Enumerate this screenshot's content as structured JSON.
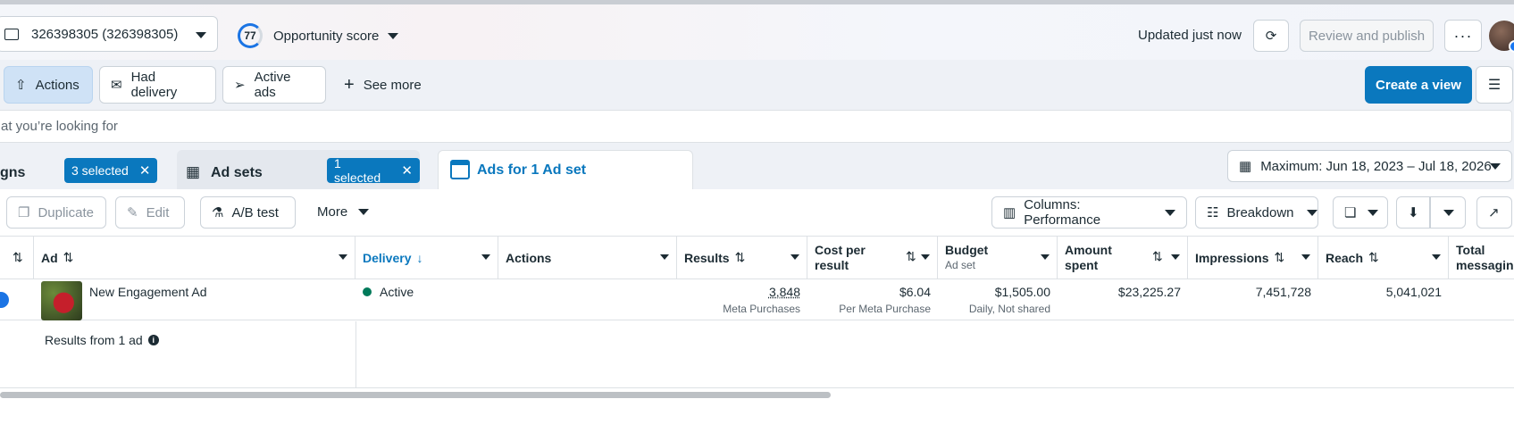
{
  "header": {
    "account_label": "326398305 (326398305)",
    "opportunity_score": "77",
    "opportunity_label": "Opportunity score",
    "updated": "Updated just now",
    "review_publish": "Review and publish",
    "more": "···"
  },
  "filters": {
    "items": [
      {
        "label": "Actions",
        "icon": "upload-circle-icon",
        "active": true
      },
      {
        "label": "Had delivery",
        "icon": "envelope-icon"
      },
      {
        "label": "Active ads",
        "icon": "send-icon"
      }
    ],
    "see_more": "See more",
    "create_view": "Create a view"
  },
  "search": {
    "placeholder": "at you’re looking for"
  },
  "tabs": {
    "campaigns_label": "gns",
    "campaigns_selected": "3 selected",
    "adsets_label": "Ad sets",
    "adsets_selected": "1 selected",
    "ads_label": "Ads for 1 Ad set"
  },
  "date_range": "Maximum: Jun 18, 2023 – Jul 18, 2026",
  "toolbar": {
    "duplicate": "Duplicate",
    "edit": "Edit",
    "ab_test": "A/B test",
    "more": "More",
    "columns": "Columns: Performance",
    "breakdown": "Breakdown"
  },
  "table": {
    "headers": {
      "ad": "Ad",
      "delivery": "Delivery",
      "actions": "Actions",
      "results": "Results",
      "cost_per_result_1": "Cost per",
      "cost_per_result_2": "result",
      "budget": "Budget",
      "budget_sub": "Ad set",
      "amount_spent_1": "Amount",
      "amount_spent_2": "spent",
      "impressions": "Impressions",
      "reach": "Reach",
      "total_messaging_1": "Total",
      "total_messaging_2": "messaging"
    },
    "row": {
      "ad_name": "New Engagement Ad",
      "delivery": "Active",
      "results": "3,848",
      "results_sub": "Meta Purchases",
      "cost": "$6.04",
      "cost_sub": "Per Meta Purchase",
      "budget": "$1,505.00",
      "budget_sub": "Daily, Not shared",
      "amount_spent": "$23,225.27",
      "impressions": "7,451,728",
      "reach": "5,041,021"
    },
    "footer": "Results from 1 ad"
  },
  "colors": {
    "accent": "#0a78be",
    "active_dot": "#007a5a"
  }
}
